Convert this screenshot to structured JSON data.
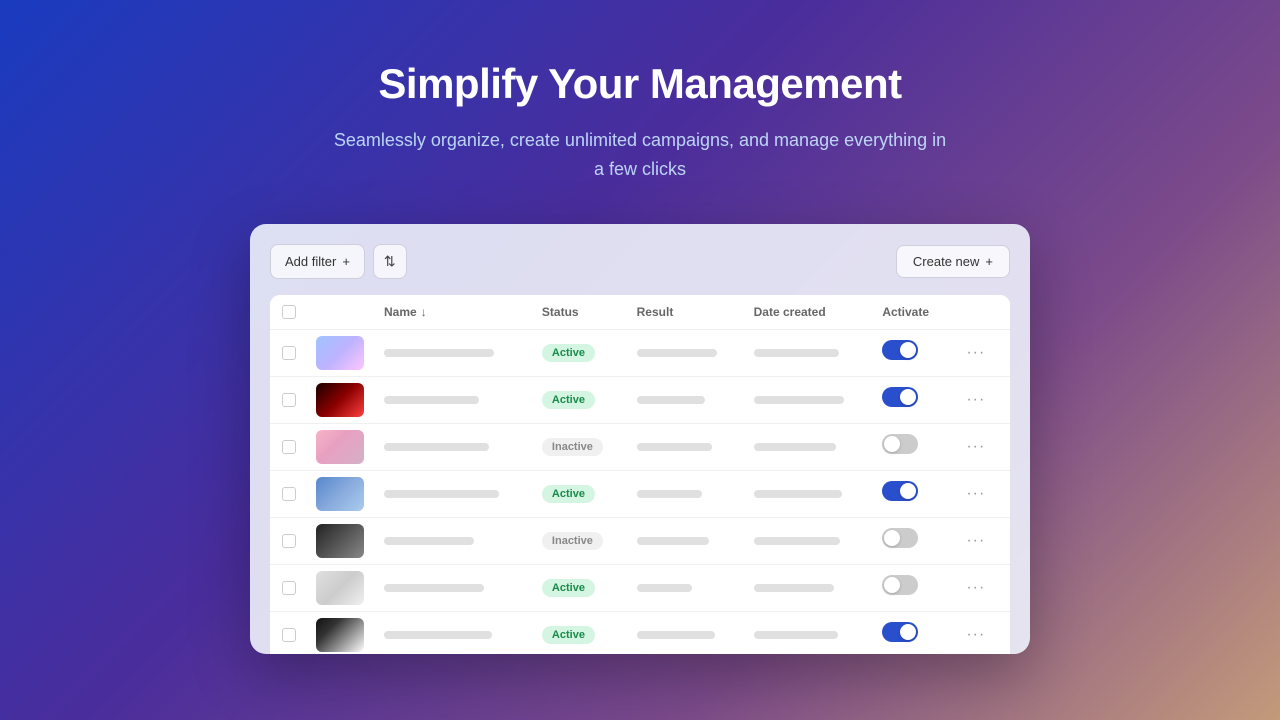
{
  "hero": {
    "title": "Simplify Your Management",
    "subtitle": "Seamlessly organize, create unlimited campaigns, and manage everything in a few clicks"
  },
  "toolbar": {
    "add_filter_label": "Add filter",
    "add_filter_icon": "+",
    "sort_icon": "⇅",
    "create_new_label": "Create new",
    "create_new_icon": "+"
  },
  "table": {
    "columns": [
      {
        "id": "checkbox",
        "label": ""
      },
      {
        "id": "thumbnail",
        "label": ""
      },
      {
        "id": "name",
        "label": "Name",
        "sortable": true
      },
      {
        "id": "status",
        "label": "Status"
      },
      {
        "id": "result",
        "label": "Result"
      },
      {
        "id": "date_created",
        "label": "Date created"
      },
      {
        "id": "activate",
        "label": "Activate"
      },
      {
        "id": "actions",
        "label": ""
      }
    ],
    "rows": [
      {
        "id": 1,
        "thumb_class": "thumb-1",
        "status": "Active",
        "status_type": "active",
        "toggle": "on",
        "more": "···"
      },
      {
        "id": 2,
        "thumb_class": "thumb-2",
        "status": "Active",
        "status_type": "active",
        "toggle": "on",
        "more": "···"
      },
      {
        "id": 3,
        "thumb_class": "thumb-3",
        "status": "Inactive",
        "status_type": "inactive",
        "toggle": "off",
        "more": "···"
      },
      {
        "id": 4,
        "thumb_class": "thumb-4",
        "status": "Active",
        "status_type": "active",
        "toggle": "on",
        "more": "···"
      },
      {
        "id": 5,
        "thumb_class": "thumb-5",
        "status": "Inactive",
        "status_type": "inactive",
        "toggle": "off",
        "more": "···"
      },
      {
        "id": 6,
        "thumb_class": "thumb-6",
        "status": "Active",
        "status_type": "active",
        "toggle": "off",
        "more": "···"
      },
      {
        "id": 7,
        "thumb_class": "thumb-7",
        "status": "Active",
        "status_type": "active",
        "toggle": "on",
        "more": "···"
      }
    ]
  },
  "colors": {
    "active_badge_bg": "#d4f5e2",
    "active_badge_text": "#1a8a4a",
    "inactive_badge_bg": "#f0f0f0",
    "inactive_badge_text": "#888888",
    "toggle_on": "#2a4fcc",
    "toggle_off": "#cccccc"
  }
}
